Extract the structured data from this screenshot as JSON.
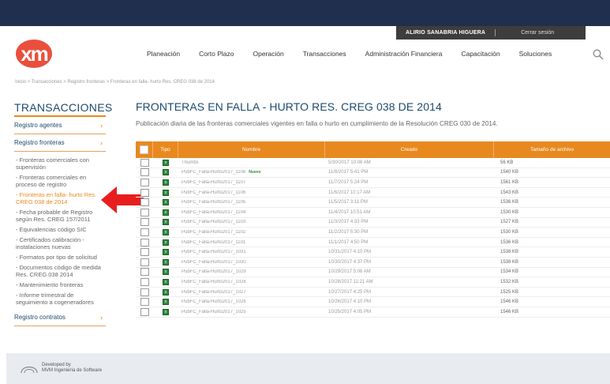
{
  "header": {
    "user_name": "ALIRIO SANABRIA HIGUERA",
    "logout": "Cerrar sesión",
    "logo_text": "xm",
    "nav": [
      "Planeación",
      "Corto Plazo",
      "Operación",
      "Transacciones",
      "Administración Financiera",
      "Capacitación",
      "Soluciones"
    ]
  },
  "breadcrumb": "Inicio > Transacciones > Registro fronteras > Fronteras en falla- hurto Res. CREG 038 de 2014",
  "sidebar": {
    "title": "TRANSACCIONES",
    "section_agentes": "Registro agentes",
    "section_fronteras": "Registro fronteras",
    "items": [
      "- Fronteras comerciales con supervisión",
      "- Fronteras comerciales en proceso de registro",
      "- Fronteras en falla- hurto Res. CREG 038 de 2014",
      "- Fecha probable de Registro según Res. CREG 157/2011",
      "- Equivalencias código SIC",
      "- Certificados calibración - instalaciones nuevas",
      "- Formatos por tipo de solicitud",
      "- Documentos código de medida Res. CREG 038 2014",
      "- Mantenimiento fronteras",
      "- Informe trimestral de seguimiento a cogeneradores"
    ],
    "section_contratos": "Registro contratos"
  },
  "main": {
    "title": "FRONTERAS EN FALLA - HURTO RES. CREG 038 DE 2014",
    "subtitle": "Publicación diaria de las fronteras comerciales vigentes en falla o hurto en cumplimiento de la Resolución CREG 030 de 2014.",
    "columns": [
      "Tipo",
      "Nombre",
      "Creado",
      "Tamaño de archivo"
    ],
    "new_badge": "Nuevo",
    "rows": [
      {
        "name": "Thumbs",
        "created": "5/30/2017 10:06 AM",
        "size": "56 KB"
      },
      {
        "name": "PubFC_Falla-Hurto2017_1108",
        "created": "11/8/2017 5:41 PM",
        "size": "1540 KB",
        "is_new": true
      },
      {
        "name": "PubFC_Falla-Hurto2017_1107",
        "created": "11/7/2017 5:24 PM",
        "size": "1561 KB"
      },
      {
        "name": "PubFC_Falla-Hurto2017_1106",
        "created": "11/6/2017 10:17 AM",
        "size": "1543 KB"
      },
      {
        "name": "PubFC_Falla-Hurto2017_1105",
        "created": "11/5/2017 3:11 PM",
        "size": "1536 KB"
      },
      {
        "name": "PubFC_Falla-Hurto2017_1104",
        "created": "11/4/2017 10:51 AM",
        "size": "1530 KB"
      },
      {
        "name": "PubFC_Falla-Hurto2017_1103",
        "created": "11/3/2017 4:33 PM",
        "size": "1527 KB"
      },
      {
        "name": "PubFC_Falla-Hurto2017_1102",
        "created": "11/2/2017 5:30 PM",
        "size": "1530 KB"
      },
      {
        "name": "PubFC_Falla-Hurto2017_1101",
        "created": "11/1/2017 4:50 PM",
        "size": "1536 KB"
      },
      {
        "name": "PubFC_Falla-Hurto2017_1031",
        "created": "10/31/2017 4:10 PM",
        "size": "1538 KB"
      },
      {
        "name": "PubFC_Falla-Hurto2017_1030",
        "created": "10/30/2017 4:37 PM",
        "size": "1538 KB"
      },
      {
        "name": "PubFC_Falla-Hurto2017_1029",
        "created": "10/29/2017 5:06 AM",
        "size": "1534 KB"
      },
      {
        "name": "PubFC_Falla-Hurto2017_1028",
        "created": "10/28/2017 11:21 AM",
        "size": "1532 KB"
      },
      {
        "name": "PubFC_Falla-Hurto2017_1027",
        "created": "10/27/2017 4:25 PM",
        "size": "1525 KB"
      },
      {
        "name": "PubFC_Falla-Hurto2017_1026",
        "created": "10/26/2017 4:10 PM",
        "size": "1546 KB"
      },
      {
        "name": "PubFC_Falla-Hurto2017_1025",
        "created": "10/25/2017 4:05 PM",
        "size": "1546 KB"
      }
    ]
  },
  "footer": {
    "line1": "Developed by",
    "line2": "MVM Ingeniería de Software"
  },
  "colors": {
    "accent": "#e8891f",
    "brand": "#ea4f3d",
    "title_blue": "#1e4a6d",
    "topbar": "#1f2f4d"
  }
}
